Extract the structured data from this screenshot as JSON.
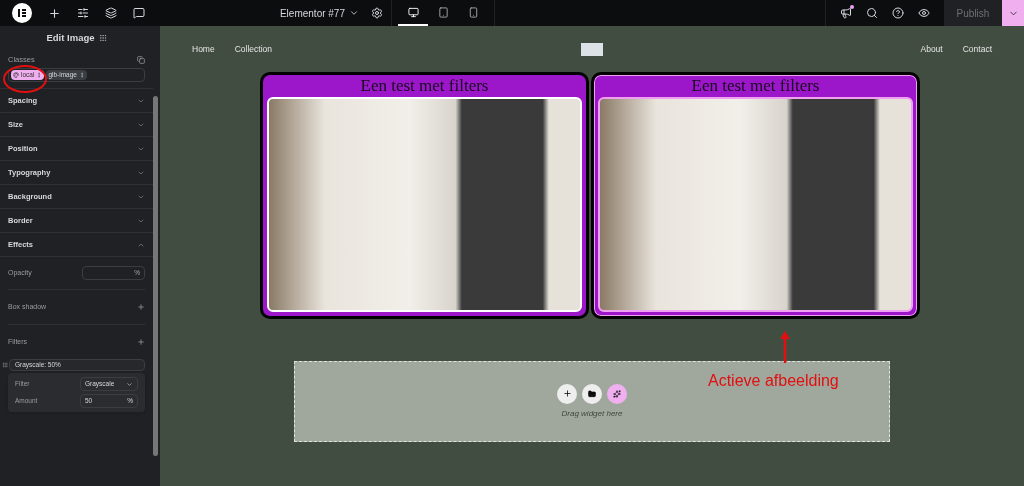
{
  "topbar": {
    "document_title": "Elementor #77",
    "devices": [
      {
        "kind": "desktop",
        "selected": true
      },
      {
        "kind": "tablet",
        "selected": false
      },
      {
        "kind": "mobile",
        "selected": false
      }
    ],
    "publish": "Publish",
    "notification_dot": true
  },
  "panel": {
    "title": "Edit Image",
    "classes_label": "Classes",
    "classes": [
      {
        "label": "local",
        "selected": true
      },
      {
        "label": "glb-image",
        "selected": false
      }
    ],
    "sections": [
      {
        "label": "Spacing",
        "expanded": false
      },
      {
        "label": "Size",
        "expanded": false
      },
      {
        "label": "Position",
        "expanded": false
      },
      {
        "label": "Typography",
        "expanded": false
      },
      {
        "label": "Background",
        "expanded": false
      },
      {
        "label": "Border",
        "expanded": false
      },
      {
        "label": "Effects",
        "expanded": true
      }
    ],
    "effects": {
      "opacity_label": "Opacity",
      "opacity_unit": "%",
      "box_shadow_label": "Box shadow",
      "filters_label": "Filters",
      "filter_items": [
        "Grayscale: 50%"
      ],
      "filter_label": "Filter",
      "filter_value": "Grayscale",
      "amount_label": "Amount",
      "amount_value": "50",
      "amount_unit": "%"
    }
  },
  "canvas": {
    "nav_left": [
      "Home",
      "Collection"
    ],
    "nav_right": [
      "About",
      "Contact"
    ],
    "cards": [
      {
        "title": "Een test met filters",
        "selected": false
      },
      {
        "title": "Een test met filters",
        "selected": true
      }
    ],
    "drop_zone": {
      "hint": "Drag widget here"
    },
    "annotation": "Actieve afbeelding"
  }
}
